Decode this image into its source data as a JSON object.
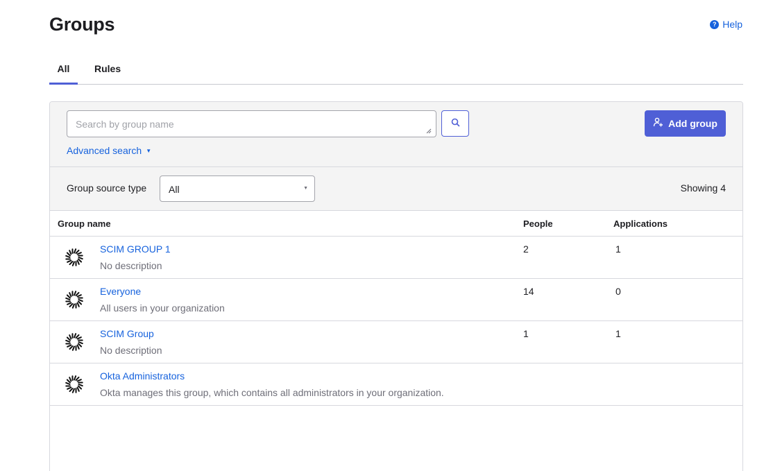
{
  "page": {
    "title": "Groups",
    "help_label": "Help"
  },
  "tabs": [
    {
      "label": "All",
      "active": true
    },
    {
      "label": "Rules",
      "active": false
    }
  ],
  "search": {
    "placeholder": "Search by group name",
    "value": "",
    "advanced_label": "Advanced search",
    "search_icon": "search-icon"
  },
  "actions": {
    "add_group_label": "Add group",
    "add_group_icon": "add-user-icon"
  },
  "filter": {
    "label": "Group source type",
    "selected": "All",
    "showing_text": "Showing 4"
  },
  "table": {
    "headers": {
      "name": "Group name",
      "people": "People",
      "applications": "Applications"
    },
    "rows": [
      {
        "name": "SCIM GROUP 1",
        "description": "No description",
        "people": "2",
        "applications": "1"
      },
      {
        "name": "Everyone",
        "description": "All users in your organization",
        "people": "14",
        "applications": "0"
      },
      {
        "name": "SCIM Group",
        "description": "No description",
        "people": "1",
        "applications": "1"
      },
      {
        "name": "Okta Administrators",
        "description": "Okta manages this group, which contains all administrators in your organization.",
        "people": "",
        "applications": ""
      }
    ]
  },
  "colors": {
    "accent": "#4f5fd6",
    "link": "#1662dd",
    "muted_text": "#6e6e78",
    "panel_bg": "#f4f4f4"
  }
}
